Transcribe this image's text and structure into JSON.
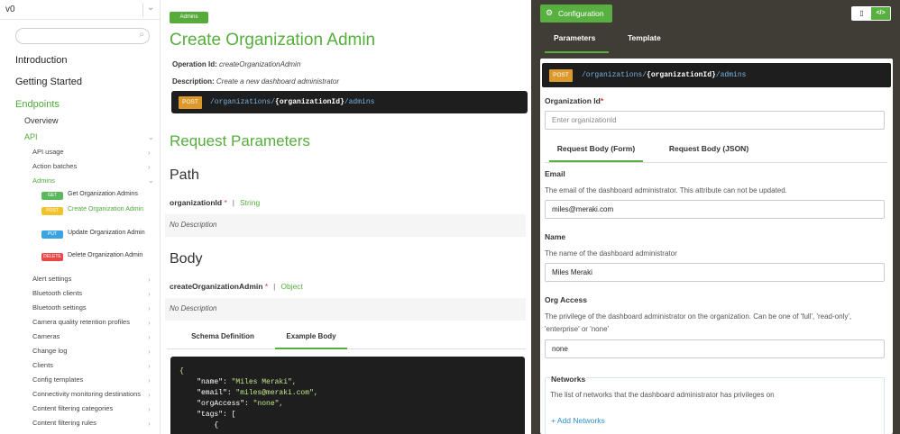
{
  "sidebar": {
    "version": "v0",
    "search_placeholder": "",
    "top_items": [
      "Introduction",
      "Getting Started"
    ],
    "endpoints_label": "Endpoints",
    "overview_label": "Overview",
    "api_label": "API",
    "api_children": [
      "API usage",
      "Action batches"
    ],
    "admins_label": "Admins",
    "admin_endpoints": [
      {
        "method": "GET",
        "label": "Get Organization Admins",
        "color": "#5cb85c",
        "active": false
      },
      {
        "method": "POST",
        "label": "Create Organization Admin",
        "color": "#f0c22e",
        "active": true
      },
      {
        "method": "PUT",
        "label": "Update Organization Admin",
        "color": "#3ba4e0",
        "active": false
      },
      {
        "method": "DELETE",
        "label": "Delete Organization Admin",
        "color": "#e94848",
        "active": false
      }
    ],
    "more_items": [
      "Alert settings",
      "Bluetooth clients",
      "Bluetooth settings",
      "Camera quality retention profiles",
      "Cameras",
      "Change log",
      "Clients",
      "Config templates",
      "Connectivity monitoring destinations",
      "Content filtering categories",
      "Content filtering rules"
    ]
  },
  "main": {
    "tag": "Admins",
    "title": "Create Organization Admin",
    "operation_id_label": "Operation Id:",
    "operation_id": "createOrganizationAdmin",
    "description_label": "Description:",
    "description": "Create a new dashboard administrator",
    "method": "POST",
    "path_prefix": "/organizations/",
    "path_param": "{organizationId}",
    "path_suffix": "/admins",
    "request_params_heading": "Request Parameters",
    "path_heading": "Path",
    "path_param_name": "organizationId",
    "path_param_type": "String",
    "path_param_desc": "No Description",
    "body_heading": "Body",
    "body_param_name": "createOrganizationAdmin",
    "body_param_type": "Object",
    "body_param_desc": "No Description",
    "tabs": [
      "Schema Definition",
      "Example Body"
    ],
    "active_tab": "Example Body",
    "code_lines": [
      {
        "indent": "",
        "key": "",
        "val": "{"
      },
      {
        "indent": "    ",
        "key": "\"name\"",
        "val": "\"Miles Meraki\","
      },
      {
        "indent": "    ",
        "key": "\"email\"",
        "val": "\"miles@meraki.com\","
      },
      {
        "indent": "    ",
        "key": "\"orgAccess\"",
        "val": "\"none\","
      },
      {
        "indent": "    ",
        "key": "\"tags\"",
        "val": "["
      },
      {
        "indent": "        ",
        "key": "",
        "val": "{"
      }
    ]
  },
  "right": {
    "config_label": "Configuration",
    "tabs": [
      "Parameters",
      "Template"
    ],
    "method": "POST",
    "path_prefix": "/organizations/",
    "path_param": "{organizationId}",
    "path_suffix": "/admins",
    "org_id_label": "Organization Id",
    "org_id_placeholder": "Enter organizationId",
    "body_tabs": [
      "Request Body (Form)",
      "Request Body (JSON)"
    ],
    "email_label": "Email",
    "email_desc": "The email of the dashboard administrator. This attribute can not be updated.",
    "email_value": "miles@meraki.com",
    "name_label": "Name",
    "name_desc": "The name of the dashboard administrator",
    "name_value": "Miles Meraki",
    "org_access_label": "Org Access",
    "org_access_desc": "The privilege of the dashboard administrator on the organization. Can be one of 'full', 'read-only', 'enterprise' or 'none'",
    "org_access_value": "none",
    "networks_label": "Networks",
    "networks_desc": "The list of networks that the dashboard administrator has privileges on",
    "add_networks_label": "Add Networks"
  },
  "colors": {
    "accent": "#56ae3d",
    "post": "#dd9a2b",
    "dark_panel": "#403d36",
    "code_bg": "#1e1e1e"
  }
}
